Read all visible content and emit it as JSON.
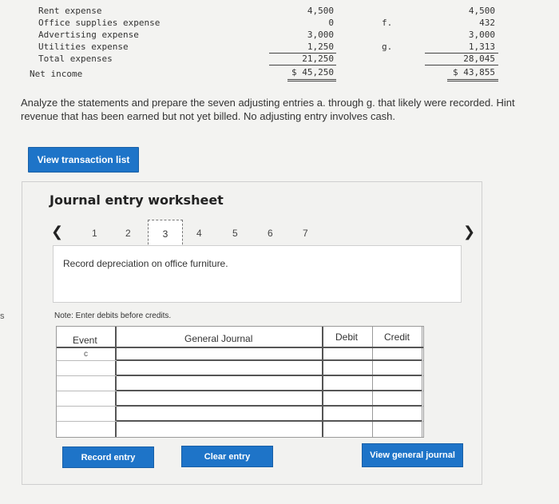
{
  "statement": {
    "lines": [
      {
        "label": "Rent expense",
        "col1": "4,500",
        "col2": "4,500"
      },
      {
        "label": "Office supplies expense",
        "col1": "0",
        "col2": "432"
      },
      {
        "label": "Advertising expense",
        "col1": "3,000",
        "col2": "3,000"
      },
      {
        "label": "Utilities expense",
        "col1": "1,250",
        "col2": "1,313"
      },
      {
        "label": "Total expenses",
        "col1": "21,250",
        "col2": "28,045"
      },
      {
        "label": "Net income",
        "col1": "$ 45,250",
        "col2": "$ 43,855"
      }
    ],
    "markers": [
      "f.",
      "g."
    ]
  },
  "instructions": "Analyze the statements and prepare the seven adjusting entries a. through g. that likely were recorded. Hint",
  "instructions_line2": "revenue that has been earned but not yet billed. No adjusting entry involves cash.",
  "left_edge_char": "s",
  "buttons": {
    "view_transactions": "View transaction list",
    "record_entry": "Record entry",
    "clear_entry": "Clear entry",
    "view_general_journal": "View general journal"
  },
  "worksheet": {
    "title": "Journal entry worksheet",
    "pager": [
      "1",
      "2",
      "3",
      "4",
      "5",
      "6",
      "7"
    ],
    "active_page": "3",
    "description": "Record depreciation on office furniture.",
    "note": "Note: Enter debits before credits.",
    "columns": {
      "event": "Event",
      "general_journal": "General Journal",
      "debit": "Debit",
      "credit": "Credit"
    },
    "first_event": "c"
  },
  "icons": {
    "prev": "chevron-left-icon",
    "next": "chevron-right-icon"
  }
}
